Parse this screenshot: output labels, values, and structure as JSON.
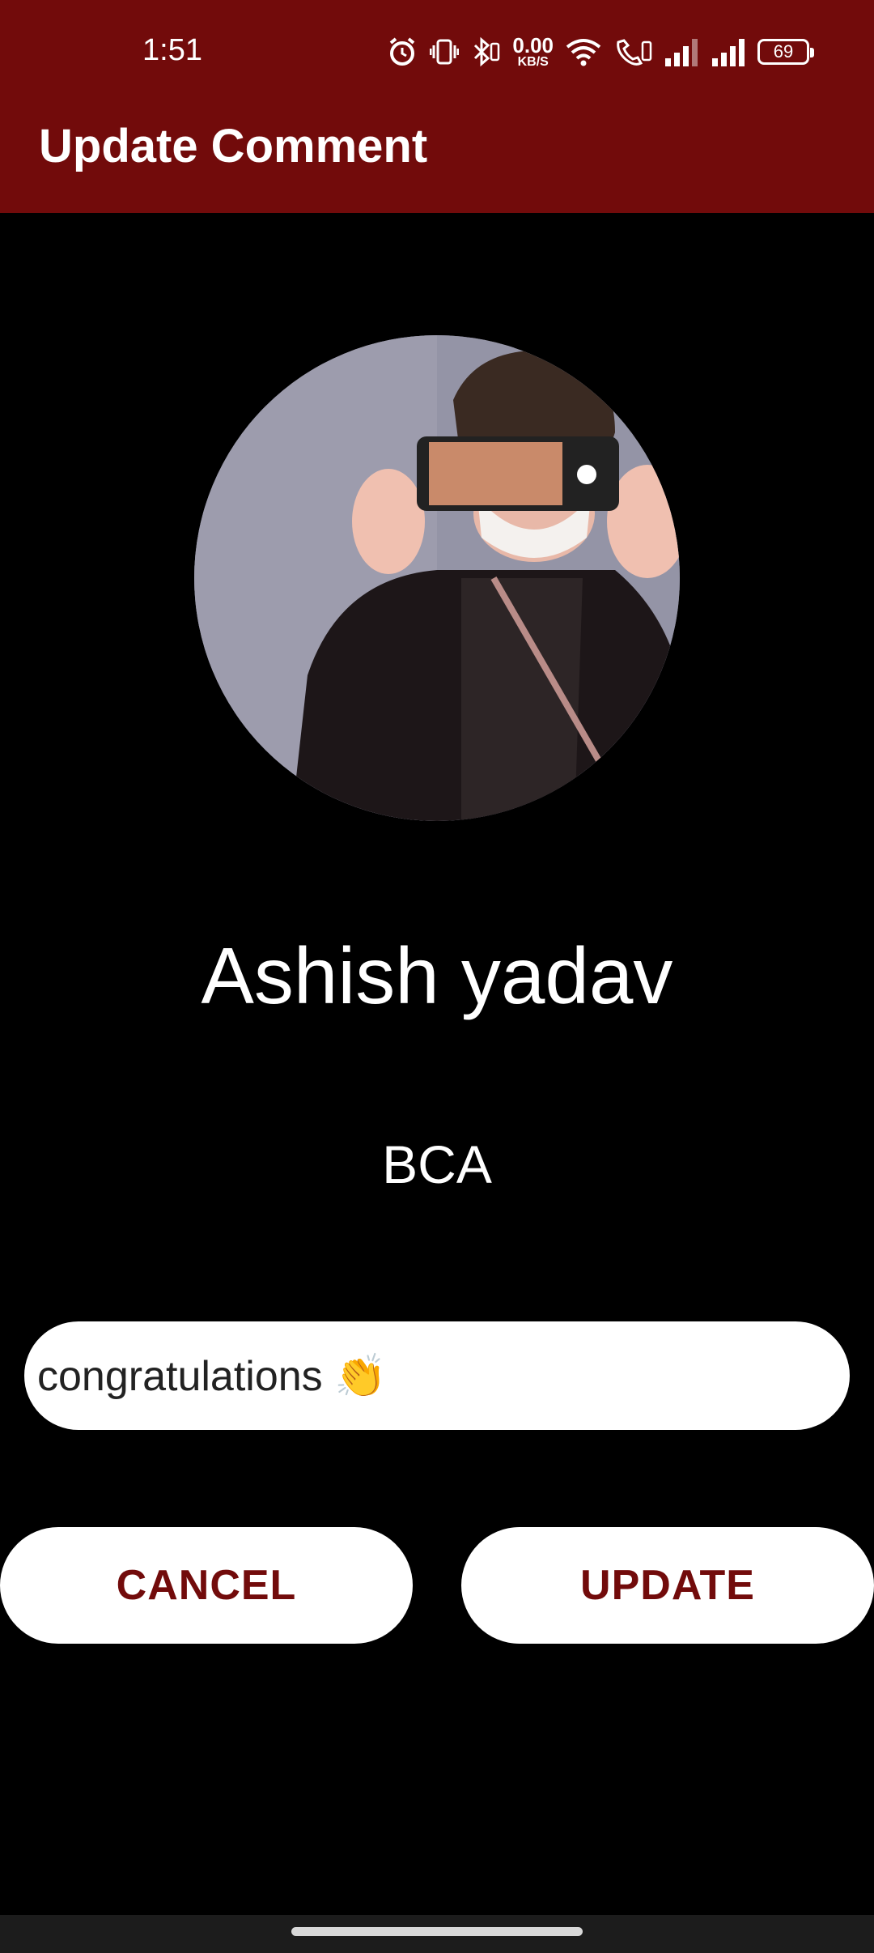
{
  "status_bar": {
    "time": "1:51",
    "net_speed_value": "0.00",
    "net_speed_unit": "KB/S",
    "battery": "69",
    "icons": [
      "alarm-icon",
      "vibrate-icon",
      "bluetooth-icon",
      "wifi-icon",
      "volte-call-icon",
      "signal-icon-1",
      "signal-icon-2"
    ]
  },
  "app_bar": {
    "title": "Update Comment"
  },
  "profile": {
    "name": "Ashish yadav",
    "course": "BCA",
    "avatar_icon": "profile-avatar"
  },
  "comment": {
    "value": "congratulations 👏"
  },
  "buttons": {
    "cancel": "CANCEL",
    "update": "UPDATE"
  },
  "colors": {
    "primary": "#720b0b",
    "background": "#000000",
    "surface": "#ffffff"
  }
}
